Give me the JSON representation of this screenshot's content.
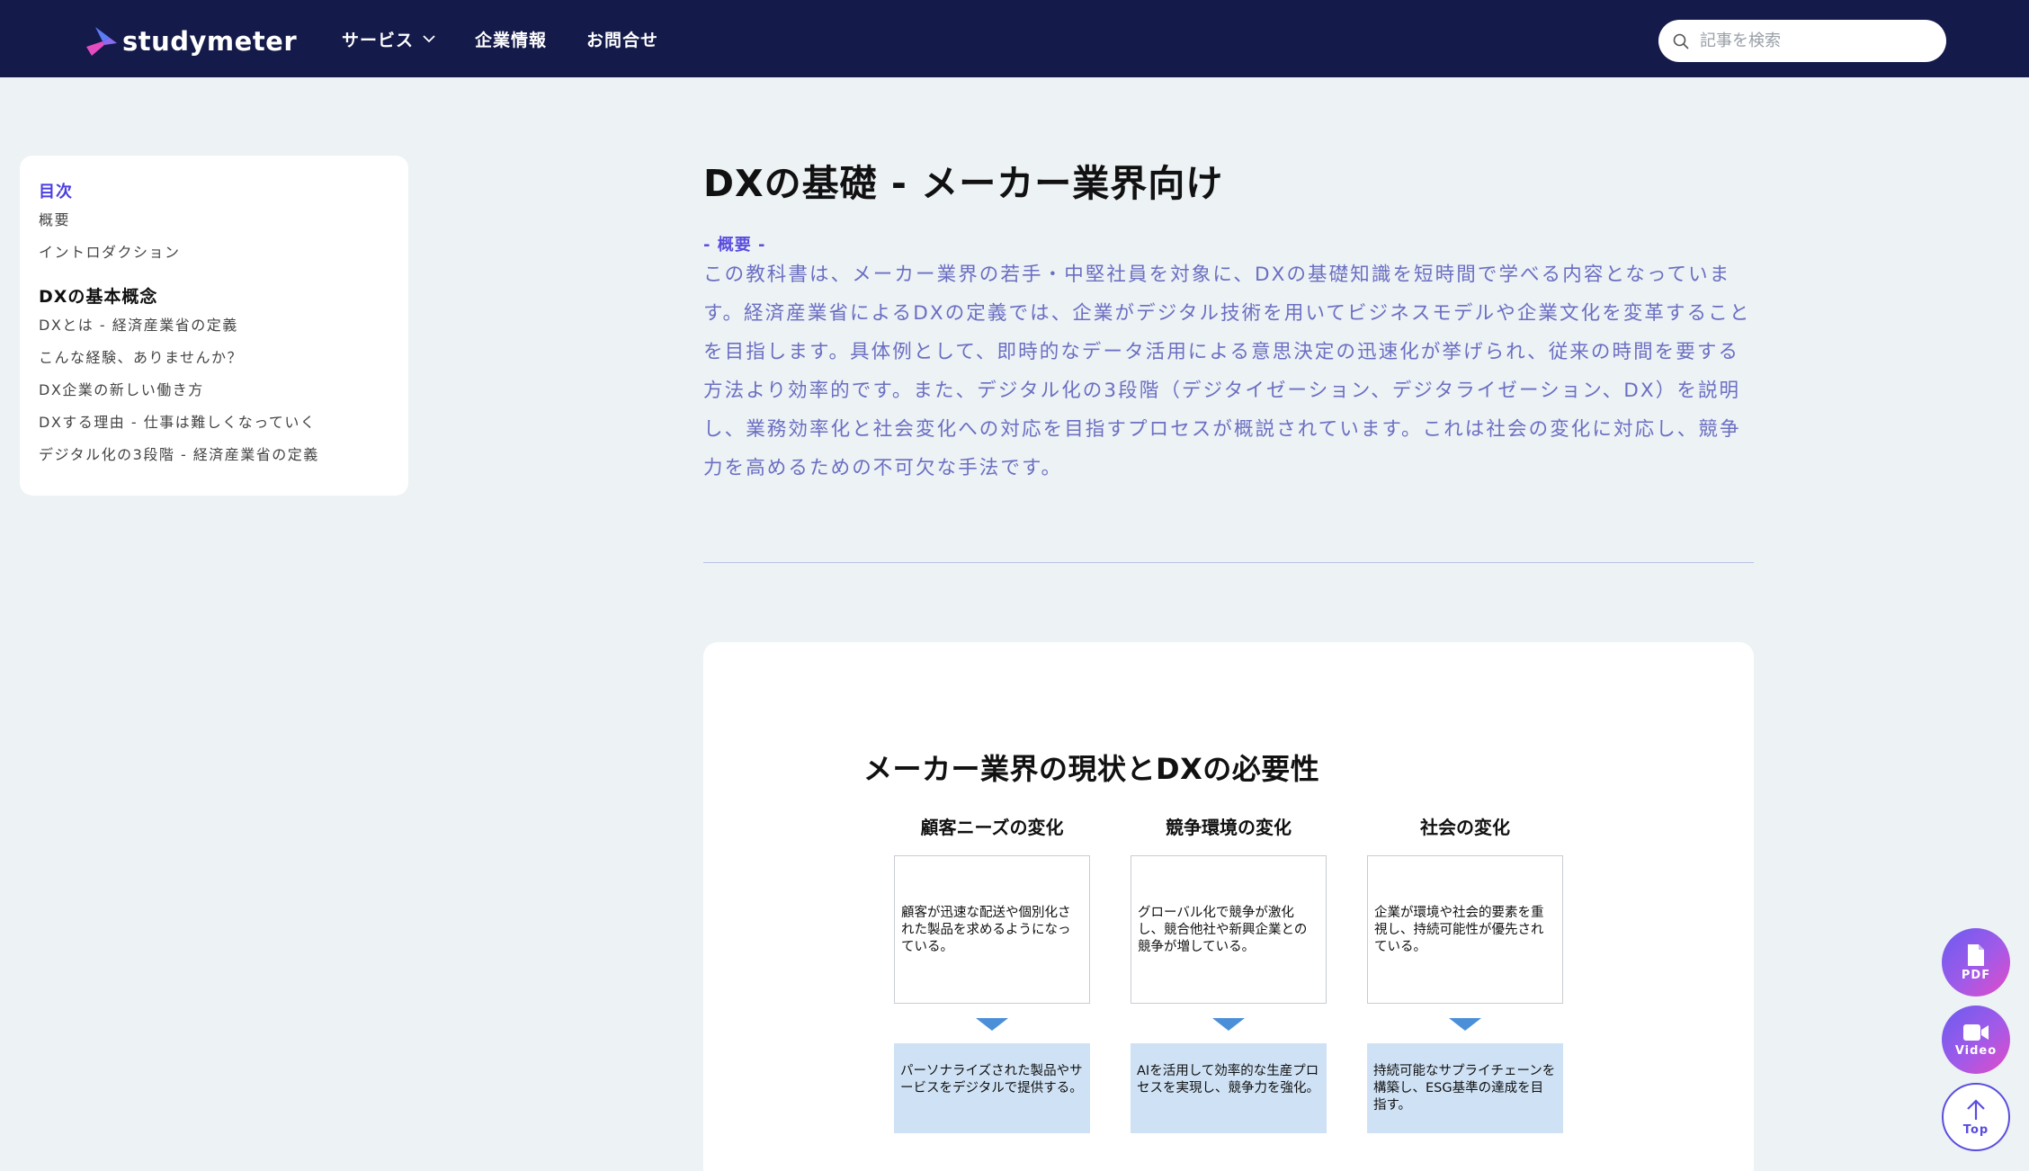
{
  "header": {
    "logo_text": "studymeter",
    "nav": [
      "サービス",
      "企業情報",
      "お問合せ"
    ],
    "search_placeholder": "記事を検索"
  },
  "toc": {
    "heading": "目次",
    "items_top": [
      "概要",
      "イントロダクション"
    ],
    "section": "DXの基本概念",
    "items_section": [
      "DXとは - 経済産業省の定義",
      "こんな経験、ありませんか？",
      "DX企業の新しい働き方",
      "DXする理由 - 仕事は難しくなっていく",
      "デジタル化の3段階 - 経済産業省の定義"
    ]
  },
  "article": {
    "title": "DXの基礎 - メーカー業界向け",
    "summary_label": "- 概要 -",
    "summary_lines": [
      "この教科書は、メーカー業界の若手・中堅社員を対象に、DXの基礎知識を短時間で学べる内容となっていま",
      "す。経済産業省によるDXの定義では、企業がデジタル技術を用いてビジネスモデルや企業文化を変革すること",
      "を目指します。具体例として、即時的なデータ活用による意思決定の迅速化が挙げられ、従来の時間を要する",
      "方法より効率的です。また、デジタル化の3段階（デジタイゼーション、デジタライゼーション、DX）を説明",
      "し、業務効率化と社会変化への対応を目指すプロセスが概説されています。これは社会の変化に対応し、競争",
      "力を高めるための不可欠な手法です。"
    ]
  },
  "figure": {
    "title": "メーカー業界の現状とDXの必要性",
    "columns": [
      {
        "head": "顧客ニーズの変化",
        "body": "顧客が迅速な配送や個別化された製品を求めるようになっている。",
        "result": "パーソナライズされた製品やサービスをデジタルで提供する。"
      },
      {
        "head": "競争環境の変化",
        "body": "グローバル化で競争が激化し、競合他社や新興企業との競争が増している。",
        "result": "AIを活用して効率的な生産プロセスを実現し、競争力を強化。"
      },
      {
        "head": "社会の変化",
        "body": "企業が環境や社会的要素を重視し、持続可能性が優先されている。",
        "result": "持続可能なサプライチェーンを構築し、ESG基準の達成を目指す。"
      }
    ],
    "colors": {
      "arrow": "#4a8fd8",
      "result_bg": "#cfe2f5"
    }
  },
  "fabs": {
    "pdf": "PDF",
    "video": "Video",
    "top": "Top"
  },
  "colors": {
    "header_bg": "#141a4a",
    "accent": "#5a4ddf",
    "summary_text": "#6b6fc2",
    "page_bg": "#edf2f5"
  }
}
